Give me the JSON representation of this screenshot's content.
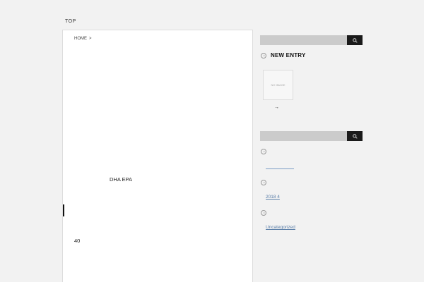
{
  "nav": {
    "top_label": "TOP"
  },
  "breadcrumb": {
    "home": "HOME",
    "separator": ">"
  },
  "main": {
    "title": "DHA EPA",
    "count": "40"
  },
  "sidebar": {
    "new_entry_title": "NEW ENTRY",
    "thumbnail_placeholder": "NO IMAGE",
    "entry_link": "→",
    "archive_link": "2018 4",
    "category_link": "Uncategorized"
  },
  "icons": {
    "search": "search-icon",
    "section": "circle-play-icon"
  },
  "colors": {
    "link": "#5a7ea8",
    "button": "#1a1a1a",
    "field": "#cbcbcb"
  }
}
